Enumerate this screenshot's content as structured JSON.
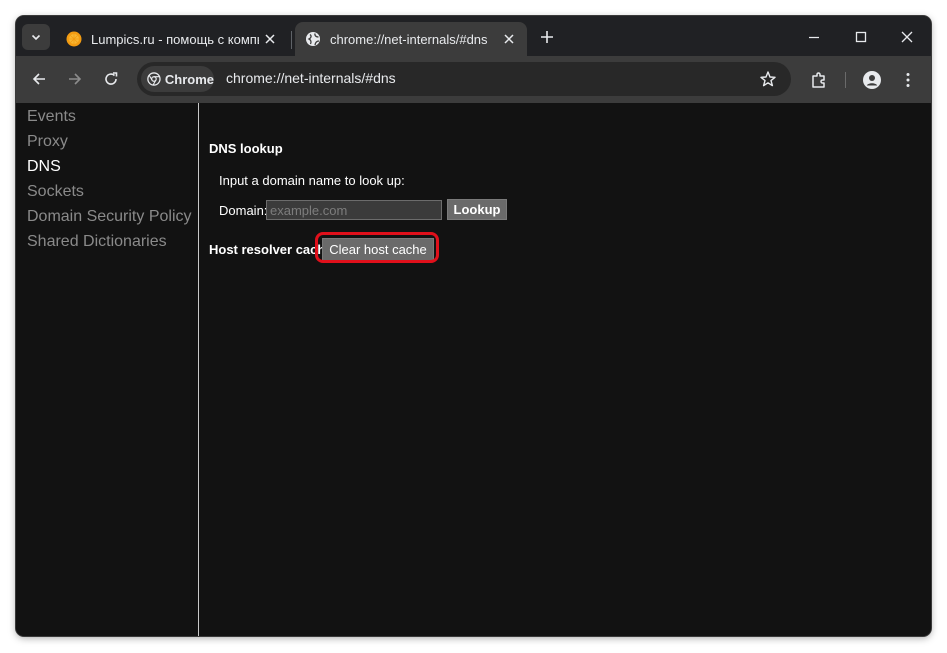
{
  "browser": {
    "tabs": [
      {
        "title": "Lumpics.ru - помощь с компьютером",
        "active": false,
        "favicon": "orange-icon"
      },
      {
        "title": "chrome://net-internals/#dns",
        "active": true,
        "favicon": "globe-icon"
      }
    ],
    "omnibox": {
      "chip_label": "Chrome",
      "url": "chrome://net-internals/#dns"
    }
  },
  "sidebar": {
    "items": [
      {
        "label": "Events",
        "selected": false
      },
      {
        "label": "Proxy",
        "selected": false
      },
      {
        "label": "DNS",
        "selected": true
      },
      {
        "label": "Sockets",
        "selected": false
      },
      {
        "label": "Domain Security Policy",
        "selected": false
      },
      {
        "label": "Shared Dictionaries",
        "selected": false
      }
    ]
  },
  "dns": {
    "lookup_heading": "DNS lookup",
    "prompt": "Input a domain name to look up:",
    "domain_label": "Domain:",
    "domain_placeholder": "example.com",
    "domain_value": "",
    "lookup_button": "Lookup",
    "host_cache_heading": "Host resolver cache",
    "clear_cache_button": "Clear host cache"
  },
  "colors": {
    "background": "#121212",
    "highlight": "#e0101b",
    "button": "#6a6a6a"
  }
}
